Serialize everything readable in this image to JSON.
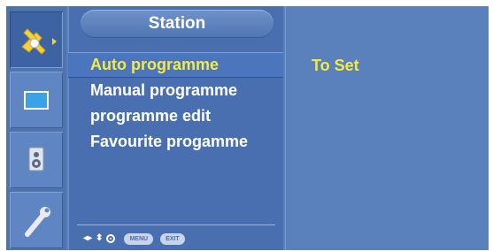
{
  "menu": {
    "title": "Station",
    "items": [
      {
        "label": "Auto programme",
        "selected": true
      },
      {
        "label": "Manual programme",
        "selected": false
      },
      {
        "label": "programme edit",
        "selected": false
      },
      {
        "label": "Favourite progamme",
        "selected": false
      }
    ]
  },
  "value_panel": {
    "value": "To Set"
  },
  "sidebar": {
    "icons": [
      "satellite-station-icon",
      "picture-screen-icon",
      "speaker-audio-icon",
      "wrench-setup-icon"
    ]
  },
  "footer": {
    "menu_label": "MENU",
    "exit_label": "EXIT"
  },
  "colors": {
    "accent_text": "#f4ea46",
    "panel_bg": "#4a6fb0",
    "osd_bg": "#5b81bc"
  }
}
